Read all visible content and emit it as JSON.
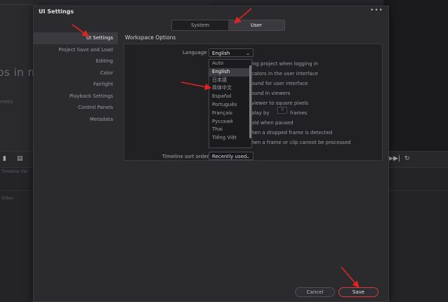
{
  "background": {
    "big_text": "ps in m",
    "small_text": "meta",
    "row_label_1": "Timeline Vid",
    "row_label_2": "Video"
  },
  "dialog": {
    "title": "UI Settings",
    "more_icon": "more-horizontal-icon",
    "tabs": [
      {
        "label": "System",
        "active": false
      },
      {
        "label": "User",
        "active": true
      }
    ],
    "sidebar": [
      {
        "label": "UI Settings",
        "active": true
      },
      {
        "label": "Project Save and Load",
        "active": false
      },
      {
        "label": "Editing",
        "active": false
      },
      {
        "label": "Color",
        "active": false
      },
      {
        "label": "Fairlight",
        "active": false
      },
      {
        "label": "Playback Settings",
        "active": false
      },
      {
        "label": "Control Panels",
        "active": false
      },
      {
        "label": "Metadata",
        "active": false
      }
    ],
    "section_title": "Workspace Options",
    "language": {
      "label": "Language",
      "value": "English",
      "options": [
        "Auto",
        "English",
        "日本語",
        "简体中文",
        "Español",
        "Português",
        "Français",
        "Русский",
        "Thai",
        "Tiếng Việt"
      ],
      "highlighted": "English"
    },
    "options": [
      "ing project when logging in",
      "cators in the user interface",
      "ound for user interface",
      "ound in viewers",
      "viewer to square pixels",
      "play by",
      "old when paused",
      "hen a dropped frame is detected",
      "hen a frame or clip cannot be processed"
    ],
    "frames_value": "0",
    "frames_suffix": "frames",
    "timeline_sort": {
      "label": "Timeline sort order",
      "value": "Recently used"
    },
    "cancel_label": "Cancel",
    "save_label": "Save"
  },
  "colors": {
    "accent_red": "#d63a3a",
    "annotation_arrow": "#e02424"
  }
}
